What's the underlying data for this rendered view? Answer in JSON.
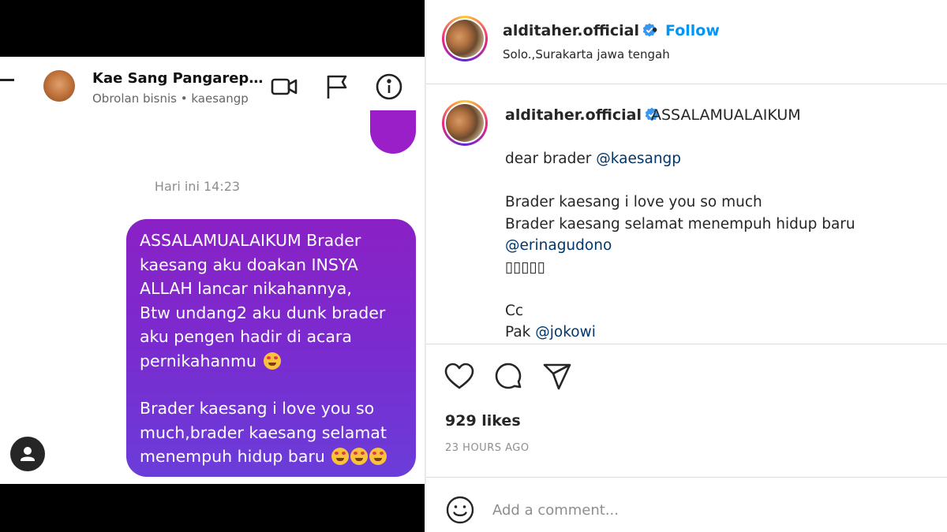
{
  "dm": {
    "contact_name": "Kae Sang Pangarep…",
    "contact_subtitle": "Obrolan bisnis • kaesangp",
    "timestamp": "Hari ini 14:23",
    "message": {
      "paragraph1_lines": [
        "ASSALAMUALAIKUM Brader",
        "kaesang aku doakan INSYA",
        "ALLAH lancar nikahannya,",
        "Btw undang2 aku dunk brader",
        "aku pengen hadir di acara",
        "pernikahanmu"
      ],
      "paragraph2_lines": [
        "Brader kaesang i love you so",
        "much,brader kaesang selamat",
        "menempuh hidup baru"
      ]
    },
    "icons": [
      "back-arrow-icon",
      "video-call-icon",
      "flag-icon",
      "info-icon",
      "user-icon"
    ]
  },
  "post": {
    "username": "alditaher.official",
    "dot": "•",
    "follow_label": "Follow",
    "location": "Solo.,Surakarta jawa tengah",
    "caption_first": "ASSALAMUALAIKUM",
    "caption": {
      "line1_text": "dear brader ",
      "line1_mention": "@kaesangp",
      "line2": "Brader kaesang i love you so much",
      "line3": "Brader kaesang selamat menempuh hidup baru",
      "line4_mention": "@erinagudono",
      "line5": "▯▯▯▯▯",
      "line6": "Cc",
      "line7_text": "Pak ",
      "line7_mention": "@jokowi"
    },
    "likes": "929 likes",
    "time_ago": "23 HOURS AGO",
    "comment_placeholder": "Add a comment...",
    "colors": {
      "follow": "#0095f6",
      "mention": "#00376b",
      "verified": "#3897f0"
    }
  }
}
